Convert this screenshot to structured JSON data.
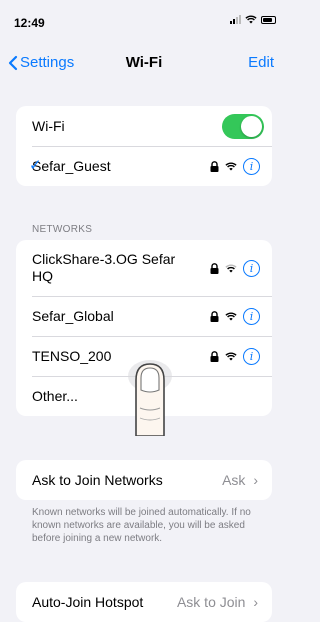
{
  "status_bar": {
    "time": "12:49"
  },
  "nav": {
    "back_label": "Settings",
    "title": "Wi-Fi",
    "edit_label": "Edit"
  },
  "wifi": {
    "label": "Wi-Fi",
    "enabled": true,
    "connected_network": "Sefar_Guest"
  },
  "networks": {
    "section_label": "NETWORKS",
    "items": [
      {
        "name": "ClickShare-3.OG Sefar HQ"
      },
      {
        "name": "Sefar_Global"
      },
      {
        "name": "TENSO_200"
      },
      {
        "name": "Other..."
      }
    ]
  },
  "ask_to_join": {
    "label": "Ask to Join Networks",
    "value": "Ask",
    "footnote": "Known networks will be joined automatically. If no known networks are available, you will be asked before joining a new network."
  },
  "auto_join": {
    "label": "Auto-Join Hotspot",
    "value": "Ask to Join"
  },
  "colors": {
    "accent": "#0a7aff",
    "toggle_on": "#34c759"
  },
  "icons": {
    "lock": "lock-icon",
    "wifi": "wifi-icon",
    "info": "info-icon",
    "check": "checkmark-icon"
  }
}
